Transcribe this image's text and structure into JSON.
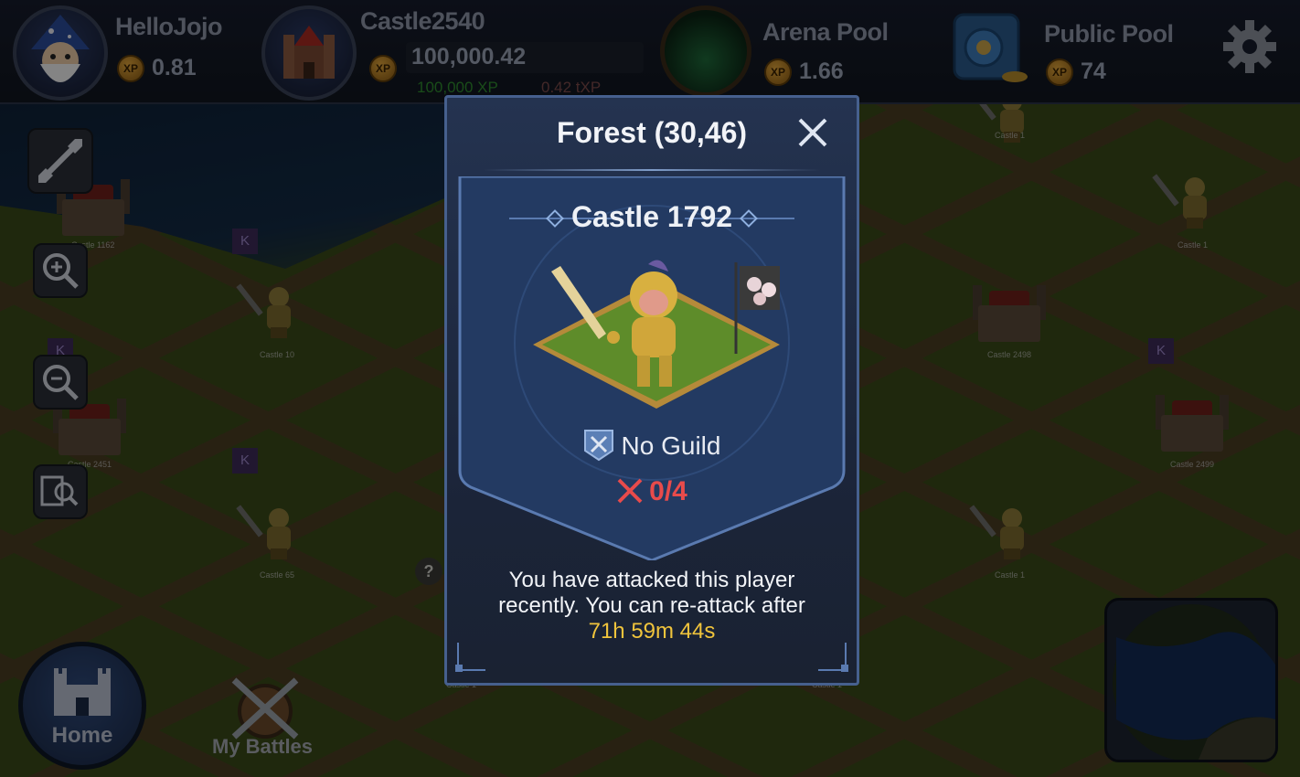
{
  "topbar": {
    "player": {
      "name": "HelloJojo",
      "xp_value": "0.81",
      "xp_badge": "XP"
    },
    "castle": {
      "name": "Castle2540",
      "balance": "100,000.42",
      "xp_amount": "100,000 XP",
      "txp_amount": "0.42 tXP",
      "xp_badge": "XP"
    },
    "arena_pool": {
      "label": "Arena Pool",
      "value": "1.66",
      "xp_badge": "XP"
    },
    "public_pool": {
      "label": "Public Pool",
      "value": "74",
      "xp_badge": "XP"
    },
    "settings_icon": "gear-icon"
  },
  "left_tools": [
    "expand-icon",
    "zoom-in-icon",
    "zoom-out-icon",
    "search-map-icon"
  ],
  "map_labels": [
    "Castle 1162",
    "Castle 10",
    "Castle 2451",
    "Castle 65",
    "Castle 1",
    "Castle 1",
    "Castle 2498",
    "Castle 2499",
    "Castle 1",
    "Castle 1",
    "Castle 1"
  ],
  "map_flag_letter": "K",
  "map_unknown_marker": "?",
  "bottom": {
    "home_label": "Home",
    "battles_label": "My Battles"
  },
  "modal": {
    "title": "Forest (30,46)",
    "castle_name": "Castle 1792",
    "guild": "No Guild",
    "attacks": "0/4",
    "message_line1": "You have attacked this player",
    "message_line2": "recently. You can re-attack after",
    "timer": "71h 59m 44s"
  },
  "colors": {
    "modal_bg": "#1b2438",
    "modal_border": "#46608e",
    "timer": "#f0c43c",
    "attack_red": "#e84b4b",
    "grass": "#3a4a18"
  }
}
